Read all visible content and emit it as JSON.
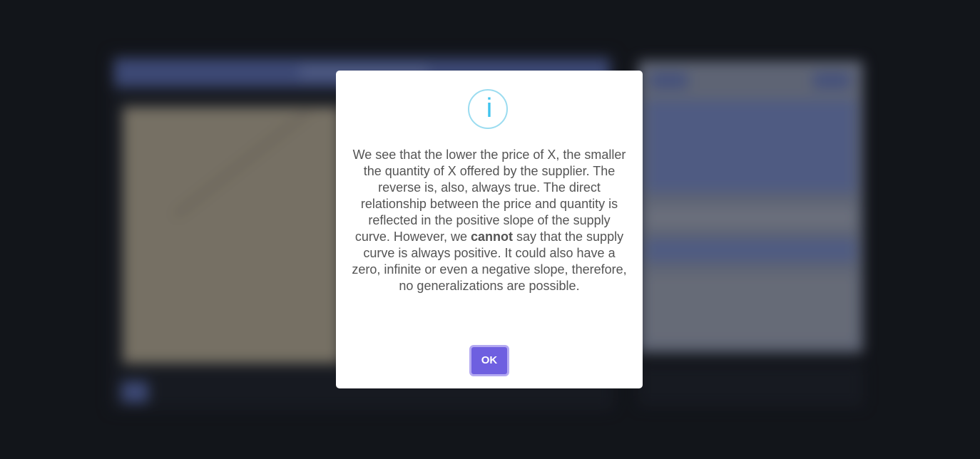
{
  "dialog": {
    "icon": "info-icon",
    "icon_glyph": "i",
    "message_part1": "We see that the lower the price of X, the smaller the quantity of X offered by the supplier. The reverse is, also, always true. The direct relationship between the price and quantity is reflected in the positive slope of the supply curve. However, we ",
    "message_bold": "cannot",
    "message_part2": " say that the supply curve is always positive. It could also have a zero, infinite or even a negative slope, therefore, no generalizations are possible.",
    "ok_label": "OK"
  },
  "colors": {
    "backdrop": "#15181e",
    "icon_border": "#9bdcf0",
    "icon_glyph": "#3fc3ee",
    "button": "#6e5fe0",
    "button_ring": "#b4a9f2",
    "text": "#545454"
  }
}
